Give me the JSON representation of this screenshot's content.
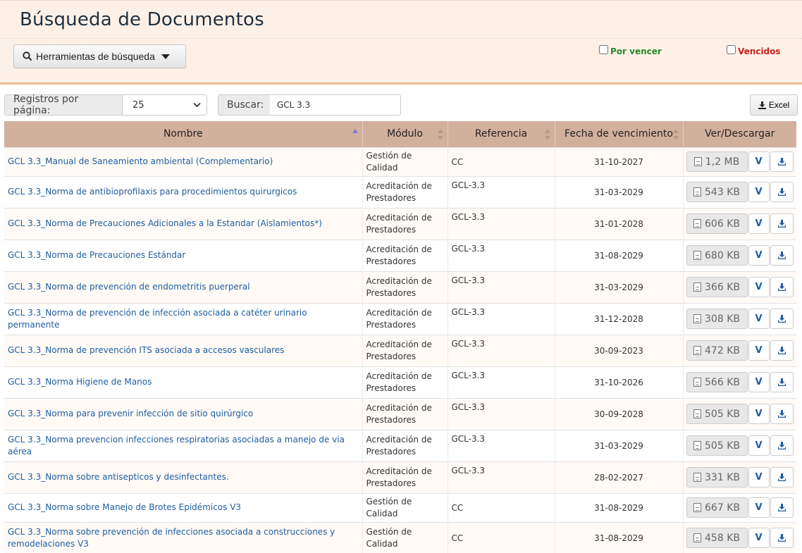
{
  "header": {
    "title": "Búsqueda de Documentos",
    "tools_button": "Herramientas de búsqueda",
    "filters": {
      "por_vencer": {
        "label": "Por vencer",
        "checked": false,
        "color": "#2a8a2a"
      },
      "vencidos": {
        "label": "Vencidos",
        "checked": false,
        "color": "#d01b1b"
      }
    }
  },
  "toolbar": {
    "per_page_label": "Registros por página:",
    "per_page_value": "25",
    "search_label": "Buscar:",
    "search_value": "GCL 3.3",
    "excel_label": "Excel"
  },
  "table": {
    "headers": [
      "Nombre",
      "Módulo",
      "Referencia",
      "Fecha de vencimiento",
      "Ver/Descargar"
    ],
    "view_label": "V",
    "rows": [
      {
        "name": "GCL 3.3_Manual de Saneamiento ambiental (Complementario)",
        "module": "Gestión de Calidad",
        "ref": "CC",
        "date": "31-10-2027",
        "size": "1,2 MB"
      },
      {
        "name": "GCL 3.3_Norma de antibioprofilaxis para procedimientos quirurgicos",
        "module": "Acreditación de Prestadores",
        "ref": "GCL-3.3",
        "date": "31-03-2029",
        "size": "543 KB"
      },
      {
        "name": "GCL 3.3_Norma de Precauciones Adicionales a la Estandar (Aislamientos*)",
        "module": "Acreditación de Prestadores",
        "ref": "GCL-3.3",
        "date": "31-01-2028",
        "size": "606 KB"
      },
      {
        "name": "GCL 3.3_Norma de Precauciones Estándar",
        "module": "Acreditación de Prestadores",
        "ref": "GCL-3.3",
        "date": "31-08-2029",
        "size": "680 KB"
      },
      {
        "name": "GCL 3.3_Norma de prevención de endometritis puerperal",
        "module": "Acreditación de Prestadores",
        "ref": "GCL-3.3",
        "date": "31-03-2029",
        "size": "366 KB"
      },
      {
        "name": "GCL 3.3_Norma de prevención de infección asociada a catéter urinario permanente",
        "module": "Acreditación de Prestadores",
        "ref": "GCL-3.3",
        "date": "31-12-2028",
        "size": "308 KB"
      },
      {
        "name": "GCL 3.3_Norma de prevención ITS asociada a accesos vasculares",
        "module": "Acreditación de Prestadores",
        "ref": "GCL-3.3",
        "date": "30-09-2023",
        "size": "472 KB"
      },
      {
        "name": "GCL 3.3_Norma Higiene de Manos",
        "module": "Acreditación de Prestadores",
        "ref": "GCL-3.3",
        "date": "31-10-2026",
        "size": "566 KB"
      },
      {
        "name": "GCL 3.3_Norma para prevenir infección de sitio quirúrgico",
        "module": "Acreditación de Prestadores",
        "ref": "GCL-3.3",
        "date": "30-09-2028",
        "size": "505 KB"
      },
      {
        "name": "GCL 3.3_Norma prevencion infecciones respiratorias asociadas a manejo de via aérea",
        "module": "Acreditación de Prestadores",
        "ref": "GCL-3.3",
        "date": "31-03-2029",
        "size": "505 KB"
      },
      {
        "name": "GCL 3.3_Norma sobre antisepticos y desinfectantes.",
        "module": "Acreditación de Prestadores",
        "ref": "GCL-3.3",
        "date": "28-02-2027",
        "size": "331 KB"
      },
      {
        "name": "GCL 3.3_Norma sobre Manejo de Brotes Epidémicos V3",
        "module": "Gestión de Calidad",
        "ref": "CC",
        "date": "31-08-2029",
        "size": "667 KB"
      },
      {
        "name": "GCL 3.3_Norma sobre prevención de infecciones asociada a construcciones y remodelaciones V3",
        "module": "Gestión de Calidad",
        "ref": "CC",
        "date": "31-08-2029",
        "size": "458 KB"
      }
    ]
  }
}
